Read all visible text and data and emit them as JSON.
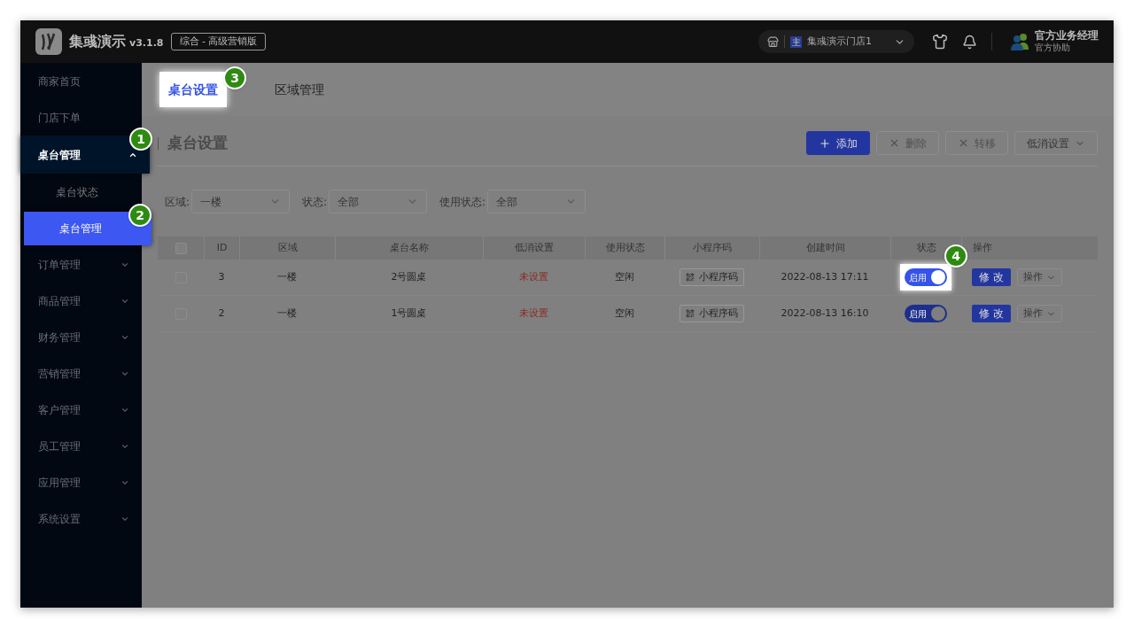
{
  "header": {
    "brand": "集彧演示",
    "version": "v3.1.8",
    "edition": "综合 - 高级营销版",
    "store": {
      "badge": "主",
      "name": "集彧演示门店1"
    },
    "user": {
      "name": "官方业务经理",
      "role": "官方协助"
    }
  },
  "sidebar": {
    "items": [
      {
        "label": "商家首页",
        "selected": false
      },
      {
        "label": "门店下单",
        "selected": false
      },
      {
        "label": "桌台管理",
        "selected": false,
        "expanded": true,
        "highlighted": true,
        "callout": "1",
        "children": [
          {
            "label": "桌台状态",
            "selected": false,
            "highlighted": false
          },
          {
            "label": "桌台管理",
            "selected": true,
            "highlighted": true,
            "callout": "2"
          }
        ]
      },
      {
        "label": "订单管理",
        "selected": false,
        "expanded": false,
        "highlighted": false
      },
      {
        "label": "商品管理",
        "selected": false,
        "expanded": false,
        "highlighted": false
      },
      {
        "label": "财务管理",
        "selected": false,
        "expanded": false,
        "highlighted": false
      },
      {
        "label": "营销管理",
        "selected": false,
        "expanded": false,
        "highlighted": false
      },
      {
        "label": "客户管理",
        "selected": false,
        "expanded": false,
        "highlighted": false
      },
      {
        "label": "员工管理",
        "selected": false,
        "expanded": false,
        "highlighted": false
      },
      {
        "label": "应用管理",
        "selected": false,
        "expanded": false,
        "highlighted": false
      },
      {
        "label": "系统设置",
        "selected": false,
        "expanded": false,
        "highlighted": false
      }
    ]
  },
  "tabs": [
    {
      "label": "桌台设置",
      "selected": true,
      "highlighted": true,
      "callout": "3"
    },
    {
      "label": "区域管理",
      "selected": false,
      "highlighted": false
    }
  ],
  "page_title": "桌台设置",
  "toolbar": [
    {
      "kind": "primary",
      "label": "添加",
      "disabled": false
    },
    {
      "kind": "delete",
      "label": "删除",
      "disabled": true
    },
    {
      "kind": "move",
      "label": "转移",
      "disabled": true
    },
    {
      "kind": "dropdown",
      "label": "低消设置",
      "disabled": false
    }
  ],
  "filters": [
    {
      "label": "区域:",
      "value": "一楼"
    },
    {
      "label": "状态:",
      "value": "全部"
    },
    {
      "label": "使用状态:",
      "value": "全部"
    }
  ],
  "table": {
    "header_checked": false,
    "columns": [
      "ID",
      "区域",
      "桌台名称",
      "低消设置",
      "使用状态",
      "小程序码",
      "创建时间",
      "状态",
      "操作"
    ],
    "rows": [
      {
        "checked": false,
        "id": "3",
        "area": "一楼",
        "name": "2号圆桌",
        "min_spend": "未设置",
        "usage": "空闲",
        "qr": "小程序码",
        "created": "2022-08-13 17:11",
        "status": {
          "label": "启用",
          "on": true,
          "highlighted": true,
          "callout": "4"
        },
        "edit": "修 改",
        "more": "操作"
      },
      {
        "checked": false,
        "id": "2",
        "area": "一楼",
        "name": "1号圆桌",
        "min_spend": "未设置",
        "usage": "空闲",
        "qr": "小程序码",
        "created": "2022-08-13 16:10",
        "status": {
          "label": "启用",
          "on": true
        },
        "edit": "修 改",
        "more": "操作"
      }
    ]
  }
}
